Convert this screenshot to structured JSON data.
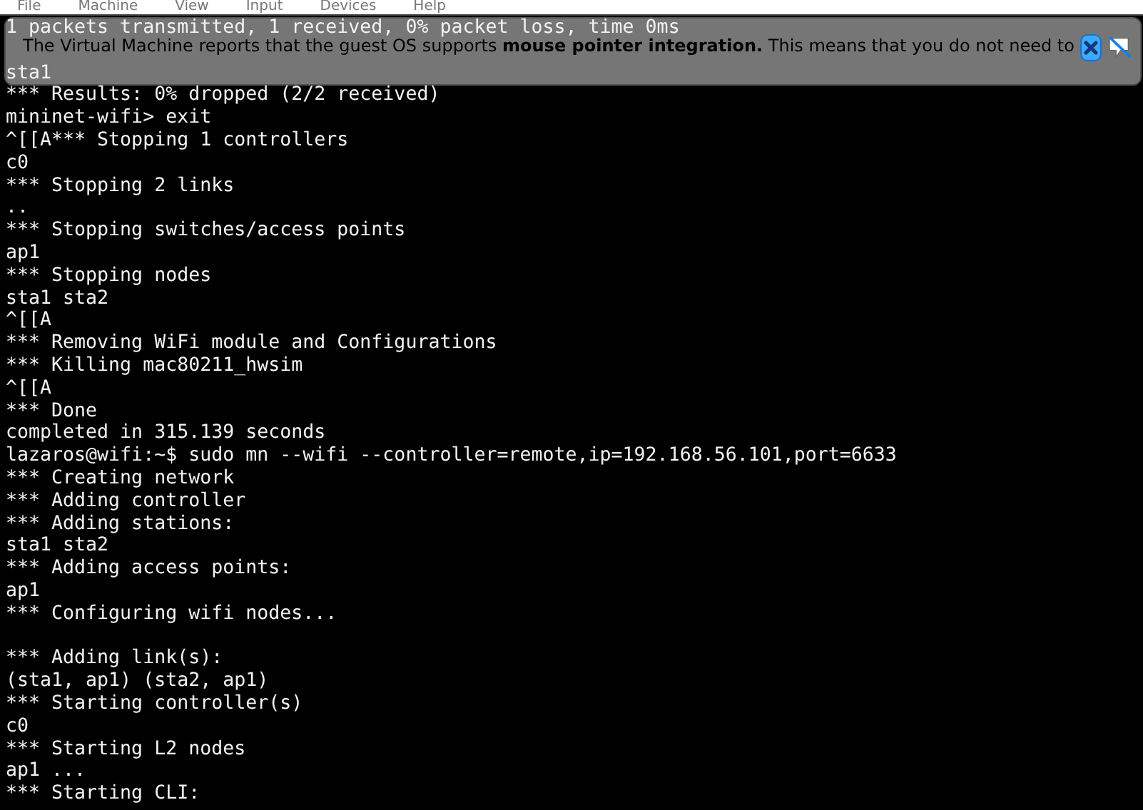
{
  "menu_bar": {
    "items": [
      "File",
      "Machine",
      "View",
      "Input",
      "Devices",
      "Help"
    ]
  },
  "notification": {
    "text": "The Virtual Machine reports that the guest OS supports **mouse pointer integration.** This means that you do not need to"
  },
  "terminal": {
    "lines": [
      {
        "kind": "text",
        "text": "1 packets transmitted, 1 received, 0% packet loss, time 0ms"
      },
      {
        "kind": "blank"
      },
      {
        "kind": "text",
        "text": "sta1"
      },
      {
        "kind": "text",
        "text": "*** Results: 0% dropped (2/2 received)"
      },
      {
        "kind": "text",
        "text": "mininet-wifi> exit"
      },
      {
        "kind": "text",
        "text": "^[[A*** Stopping 1 controllers"
      },
      {
        "kind": "text",
        "text": "c0"
      },
      {
        "kind": "text",
        "text": "*** Stopping 2 links"
      },
      {
        "kind": "text",
        "text": ".."
      },
      {
        "kind": "text",
        "text": "*** Stopping switches/access points"
      },
      {
        "kind": "text",
        "text": "ap1"
      },
      {
        "kind": "text",
        "text": "*** Stopping nodes"
      },
      {
        "kind": "text",
        "text": "sta1 sta2"
      },
      {
        "kind": "text",
        "text": "^[[A"
      },
      {
        "kind": "text",
        "text": "*** Removing WiFi module and Configurations"
      },
      {
        "kind": "text",
        "text": "*** Killing mac80211_hwsim"
      },
      {
        "kind": "text",
        "text": "^[[A"
      },
      {
        "kind": "text",
        "text": "*** Done"
      },
      {
        "kind": "text",
        "text": "completed in 315.139 seconds"
      },
      {
        "kind": "text",
        "text": "lazaros@wifi:~$ sudo mn --wifi --controller=remote,ip=192.168.56.101,port=6633"
      },
      {
        "kind": "text",
        "text": "*** Creating network"
      },
      {
        "kind": "text",
        "text": "*** Adding controller"
      },
      {
        "kind": "text",
        "text": "*** Adding stations:"
      },
      {
        "kind": "text",
        "text": "sta1 sta2"
      },
      {
        "kind": "text",
        "text": "*** Adding access points:"
      },
      {
        "kind": "text",
        "text": "ap1"
      },
      {
        "kind": "text",
        "text": "*** Configuring wifi nodes..."
      },
      {
        "kind": "blank"
      },
      {
        "kind": "text",
        "text": "*** Adding link(s):"
      },
      {
        "kind": "text",
        "text": "(sta1, ap1) (sta2, ap1)"
      },
      {
        "kind": "text",
        "text": "*** Starting controller(s)"
      },
      {
        "kind": "text",
        "text": "c0"
      },
      {
        "kind": "text",
        "text": "*** Starting L2 nodes"
      },
      {
        "kind": "text",
        "text": "ap1 ..."
      },
      {
        "kind": "text",
        "text": "*** Starting CLI:"
      }
    ]
  }
}
